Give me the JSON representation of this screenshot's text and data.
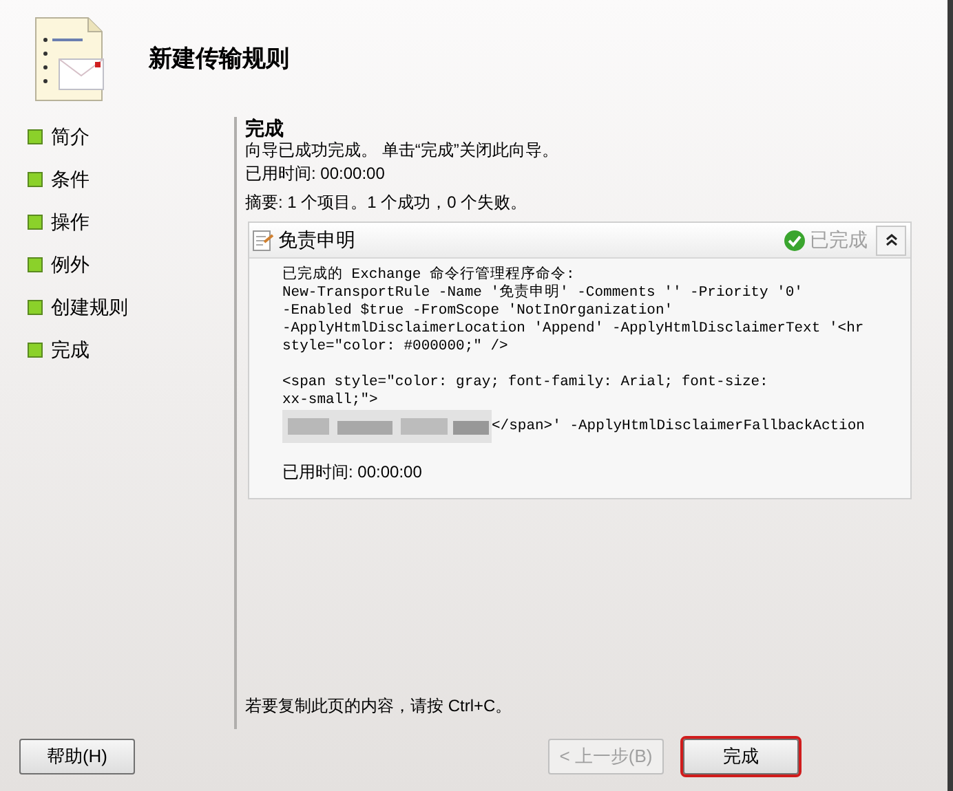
{
  "header": {
    "title": "新建传输规则"
  },
  "steps": [
    {
      "label": "简介"
    },
    {
      "label": "条件"
    },
    {
      "label": "操作"
    },
    {
      "label": "例外"
    },
    {
      "label": "创建规则"
    },
    {
      "label": "完成"
    }
  ],
  "page": {
    "title": "完成",
    "message": "向导已成功完成。 单击“完成”关闭此向导。",
    "elapsed": "已用时间: 00:00:00",
    "summary": "摘要: 1 个项目。1 个成功，0 个失败。"
  },
  "task": {
    "title": "免责申明",
    "status": "已完成",
    "expanded": true,
    "lines": [
      {
        "kind": "text",
        "text": "已完成的 Exchange 命令行管理程序命令:"
      },
      {
        "kind": "text",
        "text": "New-TransportRule -Name '免责申明' -Comments '' -Priority '0'"
      },
      {
        "kind": "text",
        "text": "-Enabled $true -FromScope 'NotInOrganization'"
      },
      {
        "kind": "text",
        "text": "-ApplyHtmlDisclaimerLocation 'Append' -ApplyHtmlDisclaimerText '<hr"
      },
      {
        "kind": "text",
        "text": "style=\"color: #000000;\" />"
      },
      {
        "kind": "blank"
      },
      {
        "kind": "text",
        "text": "<span style=\"color: gray; font-family: Arial; font-size:"
      },
      {
        "kind": "text",
        "text": "xx-small;\">"
      },
      {
        "kind": "redacted",
        "text": "</span>' -ApplyHtmlDisclaimerFallbackAction"
      }
    ],
    "elapsed": "已用时间: 00:00:00"
  },
  "hint": "若要复制此页的内容，请按 Ctrl+C。",
  "buttons": [
    {
      "label": "帮助(H)",
      "disabled": false,
      "default": false
    },
    {
      "label": "< 上一步(B)",
      "disabled": true,
      "default": false
    },
    {
      "label": "完成",
      "disabled": false,
      "default": true
    }
  ]
}
